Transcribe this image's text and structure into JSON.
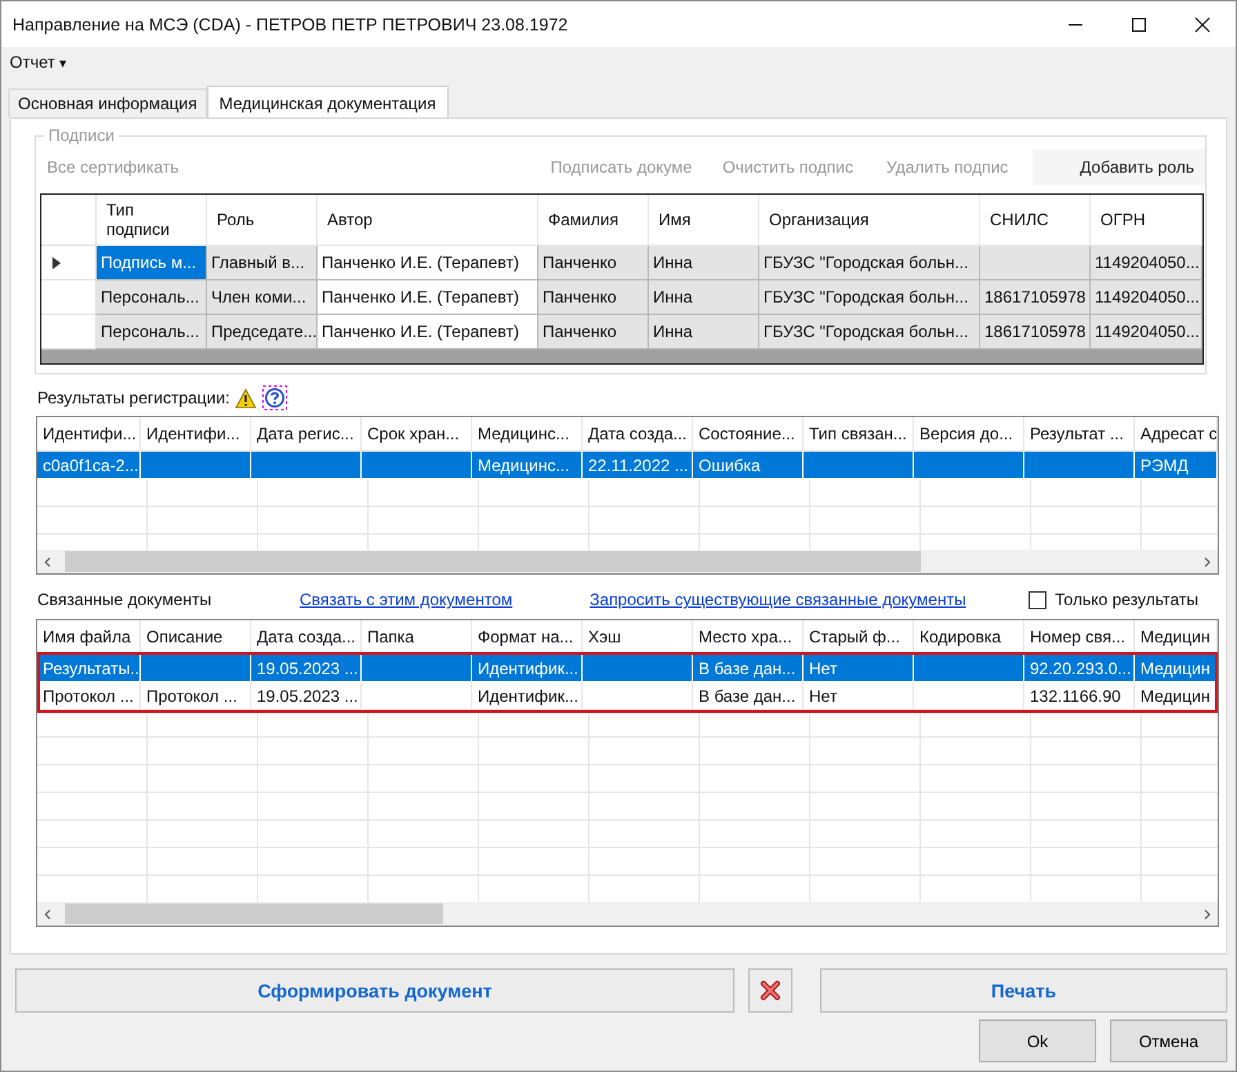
{
  "window": {
    "title": "Направление на МСЭ (CDA) - ПЕТРОВ ПЕТР ПЕТРОВИЧ 23.08.1972"
  },
  "menu": {
    "label": "Отчет",
    "arrow": "▾"
  },
  "tabs": [
    {
      "label": "Основная информация",
      "selected": false
    },
    {
      "label": "Медицинская документация",
      "selected": true
    }
  ],
  "signatures": {
    "title": "Подписи",
    "toolbar": [
      {
        "label": "Все сертификать",
        "disabled": true
      },
      {
        "label": "Подписать докуме",
        "disabled": true
      },
      {
        "label": "Очистить подпис",
        "disabled": true
      },
      {
        "label": "Удалить подпис",
        "disabled": true
      },
      {
        "label": "Добавить роль",
        "disabled": false
      }
    ],
    "columns": [
      {
        "label": "Тип подписи",
        "kind": "readonly"
      },
      {
        "label": "Роль",
        "kind": "readonly"
      },
      {
        "label": "Автор",
        "kind": "editable"
      },
      {
        "label": "Фамилия",
        "kind": "readonly"
      },
      {
        "label": "Имя",
        "kind": "readonly"
      },
      {
        "label": "Организация",
        "kind": "readonly"
      },
      {
        "label": "СНИЛС",
        "kind": "readonly"
      },
      {
        "label": "ОГРН",
        "kind": "readonly"
      }
    ],
    "rows": [
      {
        "selected": true,
        "cells": [
          "Подпись м...",
          "Главный в...",
          "Панченко И.Е. (Терапевт)",
          "Панченко",
          "Инна",
          "ГБУЗС \"Городская больн...",
          "",
          "1149204050..."
        ]
      },
      {
        "selected": false,
        "cells": [
          "Персональ...",
          "Член коми...",
          "Панченко И.Е. (Терапевт)",
          "Панченко",
          "Инна",
          "ГБУЗС \"Городская больн...",
          "18617105978",
          "1149204050..."
        ]
      },
      {
        "selected": false,
        "cells": [
          "Персональ...",
          "Председате...",
          "Панченко И.Е. (Терапевт)",
          "Панченко",
          "Инна",
          "ГБУЗС \"Городская больн...",
          "18617105978",
          "1149204050..."
        ]
      }
    ]
  },
  "registration": {
    "label": "Результаты регистрации:",
    "columns": [
      "Идентифи...",
      "Идентифи...",
      "Дата регис...",
      "Срок хран...",
      "Медицинс...",
      "Дата созда...",
      "Состояние...",
      "Тип связан...",
      "Версия до...",
      "Результат ...",
      "Адресат с"
    ],
    "rows": [
      {
        "selected": true,
        "cells": [
          "c0a0f1ca-2...",
          "",
          "",
          "",
          "Медицинс...",
          "22.11.2022 ...",
          "Ошибка",
          "",
          "",
          "",
          "РЭМД"
        ]
      }
    ]
  },
  "linked": {
    "label": "Связанные документы",
    "links": [
      "Связать с этим документом",
      "Запросить существующие связанные документы"
    ],
    "only_results": {
      "label": "Только результаты",
      "checked": false
    },
    "columns": [
      "Имя файла",
      "Описание",
      "Дата созда...",
      "Папка",
      "Формат на...",
      "Хэш",
      "Место хра...",
      "Старый ф...",
      "Кодировка",
      "Номер свя...",
      "Медицин"
    ],
    "rows": [
      {
        "selected": true,
        "cells": [
          "Результаты...",
          "",
          "19.05.2023 ...",
          "",
          "Идентифик...",
          "",
          "В базе дан...",
          "Нет",
          "",
          "92.20.293.0...",
          "Медицин"
        ]
      },
      {
        "selected": false,
        "cells": [
          "Протокол ...",
          "Протокол ...",
          "19.05.2023 ...",
          "",
          "Идентифик...",
          "",
          "В базе дан...",
          "Нет",
          "",
          "132.1166.90",
          "Медицин"
        ]
      }
    ]
  },
  "buttons": {
    "generate": "Сформировать документ",
    "print": "Печать",
    "ok": "Ok",
    "cancel": "Отмена"
  }
}
